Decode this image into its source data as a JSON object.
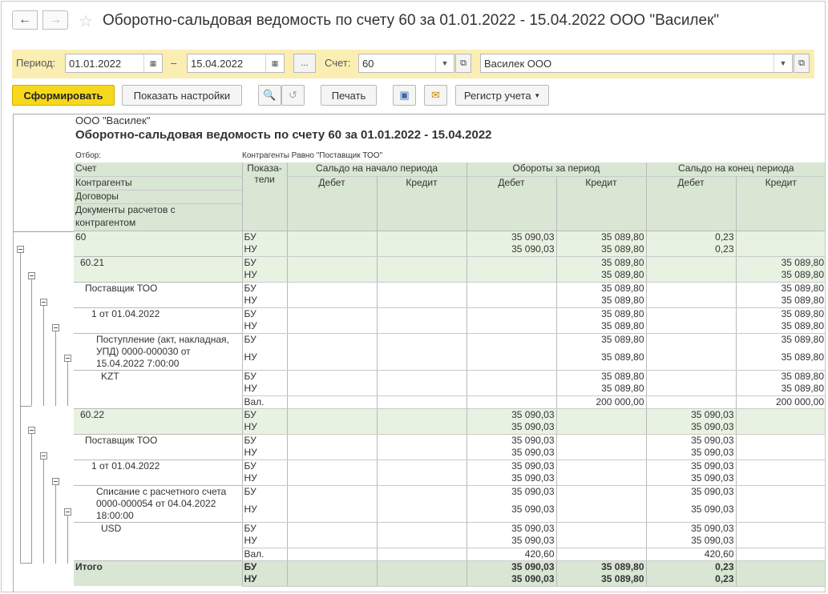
{
  "window": {
    "title": "Оборотно-сальдовая ведомость по счету 60 за 01.01.2022 - 15.04.2022 ООО \"Василек\""
  },
  "nav": {
    "back": "←",
    "forward": "→",
    "star": "☆"
  },
  "filter": {
    "period_label": "Период:",
    "date_from": "01.01.2022",
    "dash": "–",
    "date_to": "15.04.2022",
    "ellipsis": "...",
    "account_label": "Счет:",
    "account": "60",
    "organization": "Василек ООО"
  },
  "toolbar": {
    "generate": "Сформировать",
    "show_settings": "Показать настройки",
    "print": "Печать",
    "register": "Регистр учета"
  },
  "report": {
    "org": "ООО \"Василек\"",
    "title": "Оборотно-сальдовая ведомость по счету 60 за 01.01.2022 - 15.04.2022",
    "filter_label": "Отбор:",
    "filter_value": "Контрагенты Равно \"Поставщик ТОО\"",
    "headers": {
      "grouping": [
        "Счет",
        "Контрагенты",
        "Договоры",
        "Документы расчетов с контрагентом"
      ],
      "indicators": "Показа-тели",
      "opening": "Сальдо на начало периода",
      "turnover": "Обороты за период",
      "closing": "Сальдо на конец периода",
      "debit": "Дебет",
      "credit": "Кредит"
    },
    "rows": [
      {
        "name": "60",
        "indent": 0,
        "green": true,
        "lines": [
          [
            "БУ",
            "",
            "",
            "35 090,03",
            "35 089,80",
            "0,23",
            ""
          ],
          [
            "НУ",
            "",
            "",
            "35 090,03",
            "35 089,80",
            "0,23",
            ""
          ]
        ]
      },
      {
        "name": "60.21",
        "indent": 1,
        "green": true,
        "lines": [
          [
            "БУ",
            "",
            "",
            "",
            "35 089,80",
            "",
            "35 089,80"
          ],
          [
            "НУ",
            "",
            "",
            "",
            "35 089,80",
            "",
            "35 089,80"
          ]
        ]
      },
      {
        "name": "Поставщик ТОО",
        "indent": 2,
        "green": false,
        "lines": [
          [
            "БУ",
            "",
            "",
            "",
            "35 089,80",
            "",
            "35 089,80"
          ],
          [
            "НУ",
            "",
            "",
            "",
            "35 089,80",
            "",
            "35 089,80"
          ]
        ]
      },
      {
        "name": "1 от 01.04.2022",
        "indent": 3,
        "green": false,
        "lines": [
          [
            "БУ",
            "",
            "",
            "",
            "35 089,80",
            "",
            "35 089,80"
          ],
          [
            "НУ",
            "",
            "",
            "",
            "35 089,80",
            "",
            "35 089,80"
          ]
        ]
      },
      {
        "name": "Поступление (акт, накладная, УПД) 0000-000030 от 15.04.2022 7:00:00",
        "indent": 4,
        "green": false,
        "tall": true,
        "lines": [
          [
            "БУ",
            "",
            "",
            "",
            "35 089,80",
            "",
            "35 089,80"
          ],
          [
            "НУ",
            "",
            "",
            "",
            "35 089,80",
            "",
            "35 089,80"
          ]
        ]
      },
      {
        "name": "KZT",
        "indent": 5,
        "green": false,
        "lines": [
          [
            "БУ",
            "",
            "",
            "",
            "35 089,80",
            "",
            "35 089,80"
          ],
          [
            "НУ",
            "",
            "",
            "",
            "35 089,80",
            "",
            "35 089,80"
          ],
          [
            "Вал.",
            "",
            "",
            "",
            "200 000,00",
            "",
            "200 000,00"
          ]
        ]
      },
      {
        "name": "60.22",
        "indent": 1,
        "green": true,
        "lines": [
          [
            "БУ",
            "",
            "",
            "35 090,03",
            "",
            "35 090,03",
            ""
          ],
          [
            "НУ",
            "",
            "",
            "35 090,03",
            "",
            "35 090,03",
            ""
          ]
        ]
      },
      {
        "name": "Поставщик ТОО",
        "indent": 2,
        "green": false,
        "lines": [
          [
            "БУ",
            "",
            "",
            "35 090,03",
            "",
            "35 090,03",
            ""
          ],
          [
            "НУ",
            "",
            "",
            "35 090,03",
            "",
            "35 090,03",
            ""
          ]
        ]
      },
      {
        "name": "1 от 01.04.2022",
        "indent": 3,
        "green": false,
        "lines": [
          [
            "БУ",
            "",
            "",
            "35 090,03",
            "",
            "35 090,03",
            ""
          ],
          [
            "НУ",
            "",
            "",
            "35 090,03",
            "",
            "35 090,03",
            ""
          ]
        ]
      },
      {
        "name": "Списание с расчетного счета 0000-000054 от 04.04.2022 18:00:00",
        "indent": 4,
        "green": false,
        "tall": true,
        "lines": [
          [
            "БУ",
            "",
            "",
            "35 090,03",
            "",
            "35 090,03",
            ""
          ],
          [
            "НУ",
            "",
            "",
            "35 090,03",
            "",
            "35 090,03",
            ""
          ]
        ]
      },
      {
        "name": "USD",
        "indent": 5,
        "green": false,
        "lines": [
          [
            "БУ",
            "",
            "",
            "35 090,03",
            "",
            "35 090,03",
            ""
          ],
          [
            "НУ",
            "",
            "",
            "35 090,03",
            "",
            "35 090,03",
            ""
          ],
          [
            "Вал.",
            "",
            "",
            "420,60",
            "",
            "420,60",
            ""
          ]
        ]
      }
    ],
    "total": {
      "name": "Итого",
      "lines": [
        [
          "БУ",
          "",
          "",
          "35 090,03",
          "35 089,80",
          "0,23",
          ""
        ],
        [
          "НУ",
          "",
          "",
          "35 090,03",
          "35 089,80",
          "0,23",
          ""
        ]
      ]
    }
  }
}
